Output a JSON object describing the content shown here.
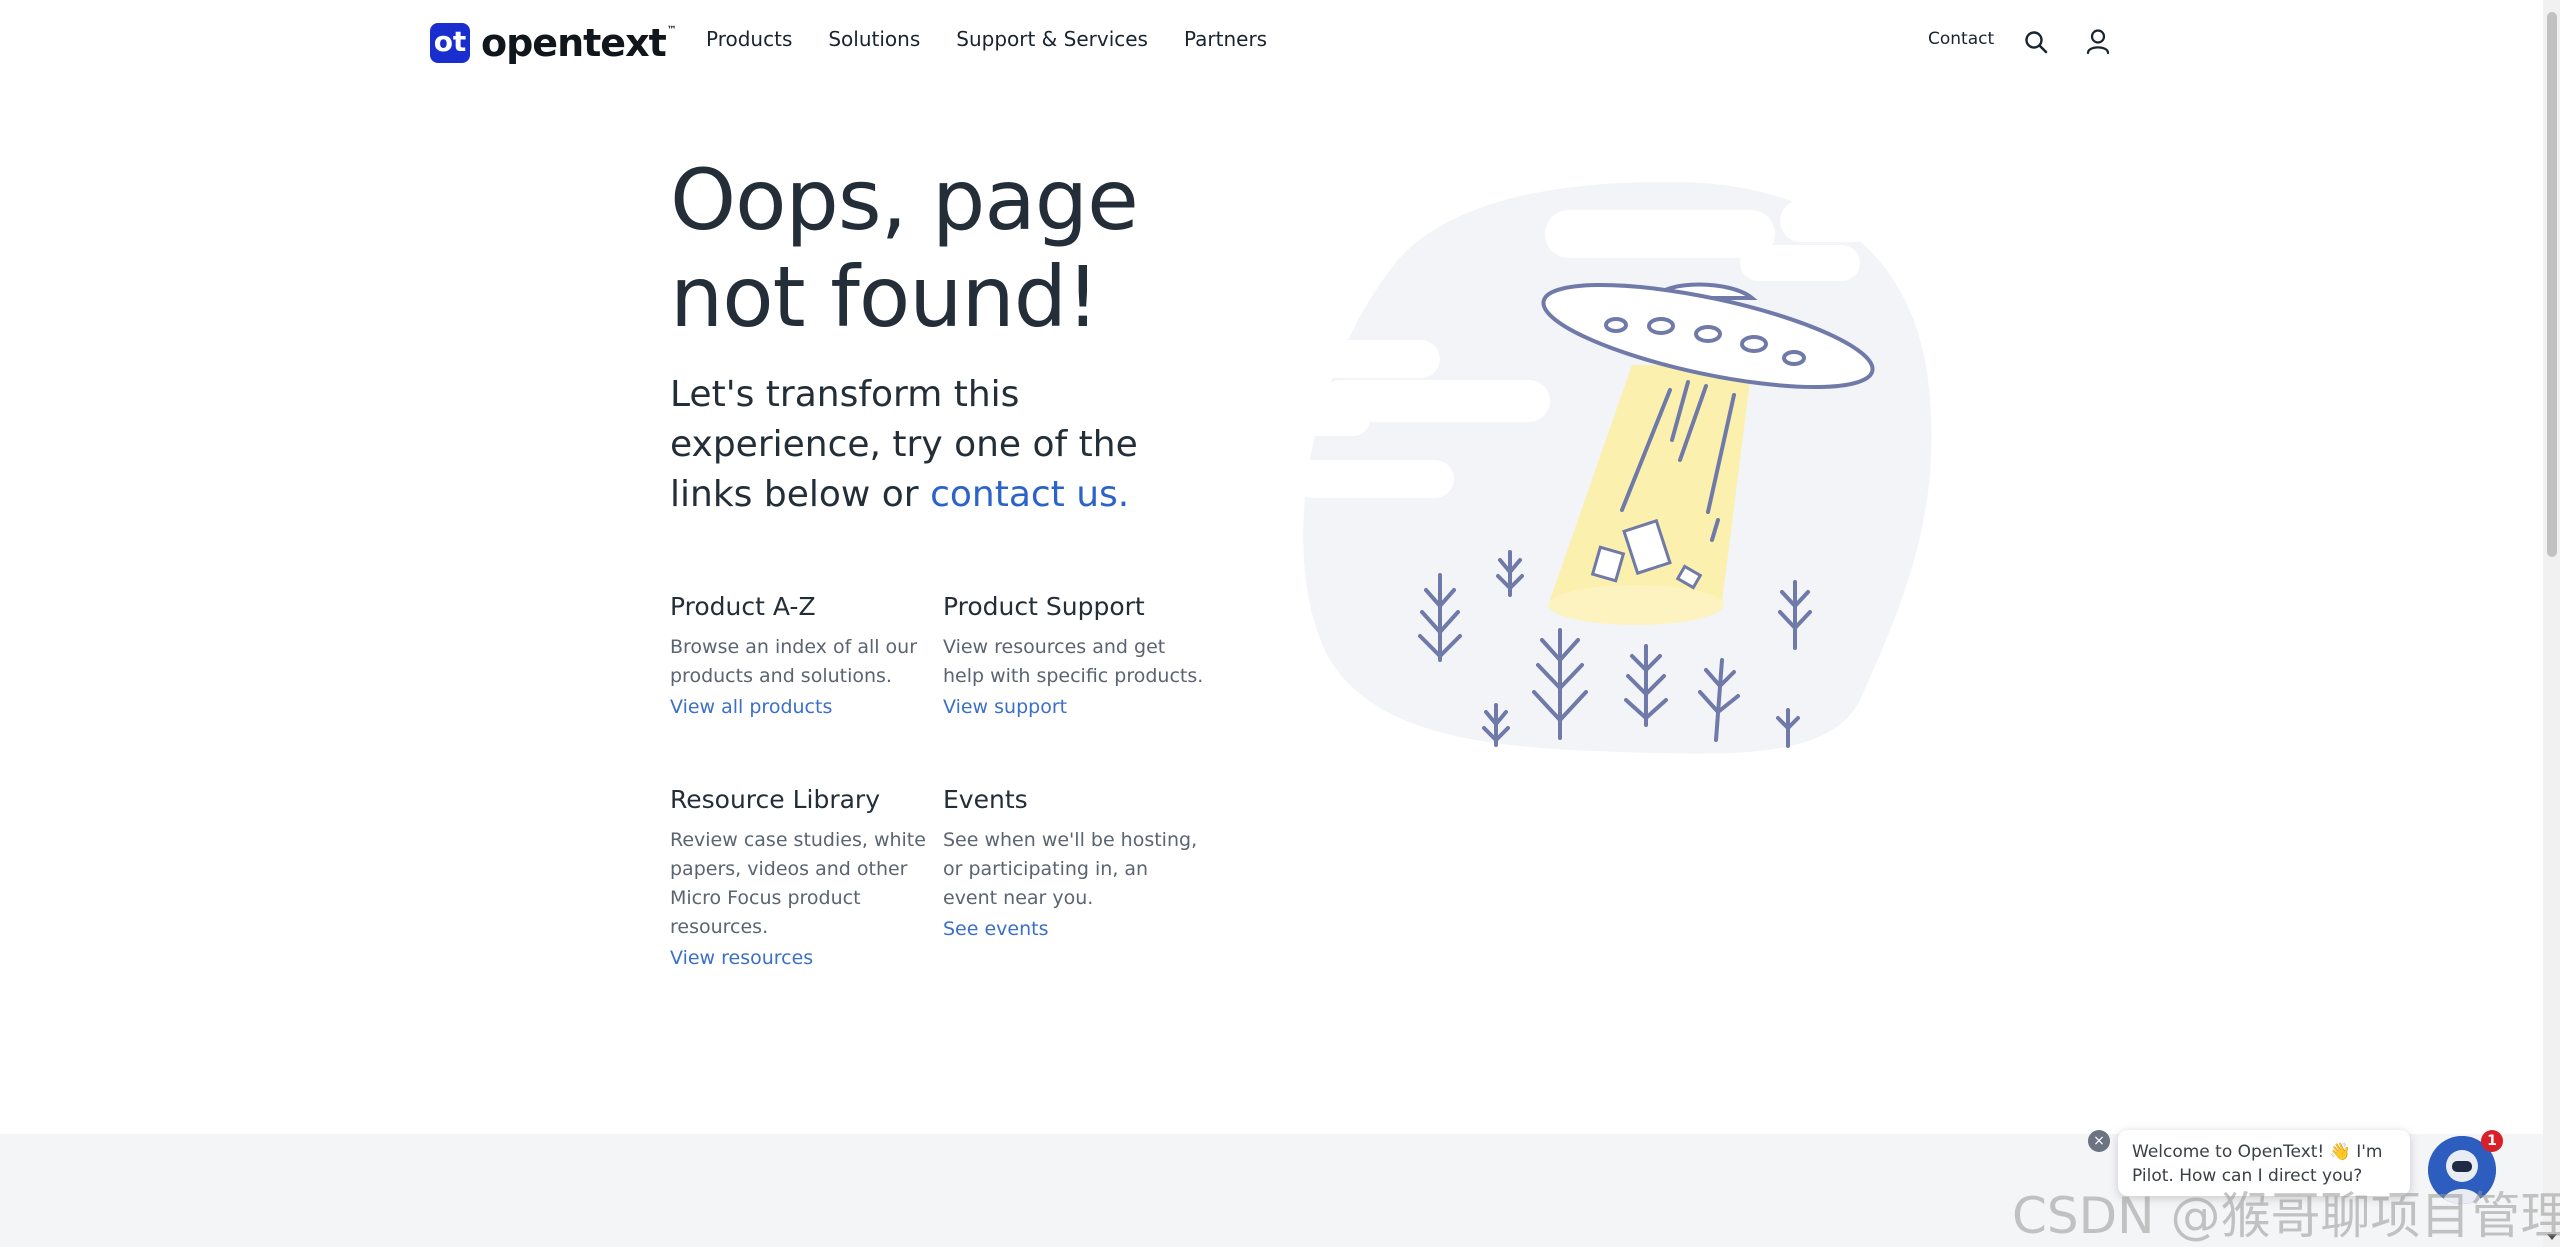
{
  "header": {
    "logo_text": "opentext",
    "logo_tm": "™",
    "logo_mark": "ot",
    "nav": [
      "Products",
      "Solutions",
      "Support & Services",
      "Partners"
    ],
    "contact": "Contact",
    "search_icon": "search-icon",
    "user_icon": "user-icon"
  },
  "hero": {
    "title_line1": "Oops, page",
    "title_line2": "not found!",
    "lead": "Let's transform this experience, try one of the links below or",
    "contact_link": "contact us."
  },
  "cards": [
    {
      "title": "Product A-Z",
      "description": "Browse an index of all our products and solutions.",
      "link": "View all products"
    },
    {
      "title": "Product Support",
      "description": "View resources and get help with specific products.",
      "link": "View support"
    },
    {
      "title": "Resource Library",
      "description": "Review case studies, white papers, videos and other Micro Focus product resources.",
      "link": "View resources"
    },
    {
      "title": "Events",
      "description": "See when we'll be hosting, or participating in, an event near you.",
      "link": "See events"
    }
  ],
  "chat": {
    "message": "Welcome to OpenText! 👋 I'm Pilot. How can I direct you?",
    "badge_count": "1",
    "close_glyph": "×"
  },
  "watermark": "CSDN @猴哥聊项目管理",
  "colors": {
    "brand_blue": "#1a2ed0",
    "link_blue": "#2b63c8",
    "text_dark": "#232e38",
    "illustration_stroke": "#6f7aa8",
    "beam_yellow": "#fbeea0",
    "footer_gray": "#f4f5f7"
  }
}
